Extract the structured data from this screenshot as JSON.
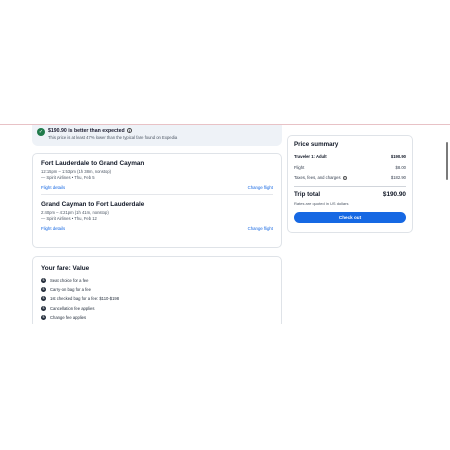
{
  "banner": {
    "title": "$190.90 is better than expected",
    "subtitle": "This price is at least 47% lower than the typical fare found on Expedia",
    "check_icon": "check-circle-icon",
    "info_icon": "info-icon"
  },
  "flights": [
    {
      "route": "Fort Lauderdale to Grand Cayman",
      "time": "12:15pm – 1:53pm (1h 38m, nonstop)",
      "airline": "— Spirit Airlines • Thu, Feb 5",
      "details_link": "Flight details",
      "change_link": "Change flight"
    },
    {
      "route": "Grand Cayman to Fort Lauderdale",
      "time": "2:40pm – 4:21pm (1h 41m, nonstop)",
      "airline": "— Spirit Airlines • Thu, Feb 12",
      "details_link": "Flight details",
      "change_link": "Change flight"
    }
  ],
  "fare": {
    "title": "Your fare: Value",
    "items": [
      "Seat choice for a fee",
      "Carry-on bag for a fee",
      "1st checked bag for a fee: $110-$198",
      "Cancellation fee applies",
      "Change fee applies"
    ],
    "bullet_icon": "dollar-icon"
  },
  "summary": {
    "title": "Price summary",
    "traveler_label": "Traveler 1: Adult",
    "traveler_value": "$190.90",
    "flight_label": "Flight",
    "flight_value": "$8.00",
    "taxes_label": "Taxes, fees, and charges",
    "taxes_value": "$182.90",
    "total_label": "Trip total",
    "total_value": "$190.90",
    "rates_note": "Rates are quoted in US dollars",
    "checkout_label": "Check out"
  },
  "colors": {
    "accent": "#1668e3",
    "success": "#1f7a4a",
    "banner_bg": "#eef2f7"
  }
}
